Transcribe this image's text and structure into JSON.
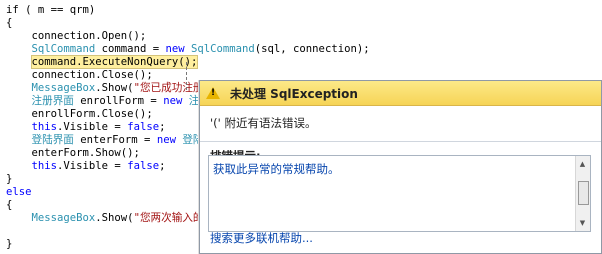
{
  "code": [
    [
      {
        "t": "if ( m == qrm)"
      }
    ],
    [
      {
        "t": "{"
      }
    ],
    [
      {
        "t": "    connection.Open();"
      }
    ],
    [
      {
        "t": "    ",
        "c": ""
      },
      {
        "t": "SqlCommand",
        "c": "ty"
      },
      {
        "t": " command = "
      },
      {
        "t": "new",
        "c": "kw"
      },
      {
        "t": " "
      },
      {
        "t": "SqlCommand",
        "c": "ty"
      },
      {
        "t": "(sql, connection);"
      }
    ],
    [
      {
        "t": "    "
      },
      {
        "t": "command.ExecuteNonQuery();",
        "c": "hl"
      }
    ],
    [
      {
        "t": "    connection.Close();"
      }
    ],
    [
      {
        "t": "    "
      },
      {
        "t": "MessageBox",
        "c": "ty"
      },
      {
        "t": ".Show("
      },
      {
        "t": "\"您已成功注册",
        "c": "str"
      }
    ],
    [
      {
        "t": "    "
      },
      {
        "t": "注册界面",
        "c": "ty"
      },
      {
        "t": " enrollForm = "
      },
      {
        "t": "new",
        "c": "kw"
      },
      {
        "t": " "
      },
      {
        "t": "注",
        "c": "ty"
      }
    ],
    [
      {
        "t": "    enrollForm.Close();"
      }
    ],
    [
      {
        "t": "    "
      },
      {
        "t": "this",
        "c": "kw"
      },
      {
        "t": ".Visible = "
      },
      {
        "t": "false",
        "c": "kw"
      },
      {
        "t": ";"
      }
    ],
    [
      {
        "t": "    "
      },
      {
        "t": "登陆界面",
        "c": "ty"
      },
      {
        "t": " enterForm = "
      },
      {
        "t": "new",
        "c": "kw"
      },
      {
        "t": " "
      },
      {
        "t": "登陆",
        "c": "ty"
      }
    ],
    [
      {
        "t": "    enterForm.Show();"
      }
    ],
    [
      {
        "t": "    "
      },
      {
        "t": "this",
        "c": "kw"
      },
      {
        "t": ".Visible = "
      },
      {
        "t": "false",
        "c": "kw"
      },
      {
        "t": ";"
      }
    ],
    [
      {
        "t": "}"
      }
    ],
    [
      {
        "t": "else",
        "c": "kw"
      }
    ],
    [
      {
        "t": "{"
      }
    ],
    [
      {
        "t": "    "
      },
      {
        "t": "MessageBox",
        "c": "ty"
      },
      {
        "t": ".Show("
      },
      {
        "t": "\"您两次输入的",
        "c": "str"
      }
    ],
    [
      {
        "t": ""
      }
    ],
    [
      {
        "t": "}"
      }
    ]
  ],
  "exception": {
    "title": "未处理 SqlException",
    "message": "'(' 附近有语法错误。",
    "tips_label": "排错提示:",
    "tip_link": "获取此异常的常规帮助。",
    "more_link": "搜索更多联机帮助..."
  },
  "icons": {
    "warning": "warning-triangle-icon",
    "scroll_up": "scroll-up-icon",
    "scroll_down": "scroll-down-icon"
  },
  "colors": {
    "keyword": "#0000ff",
    "type": "#2b91af",
    "string": "#a31515",
    "highlight": "#ffef9f",
    "title_bar": "#f6d456",
    "link": "#0645ad"
  }
}
